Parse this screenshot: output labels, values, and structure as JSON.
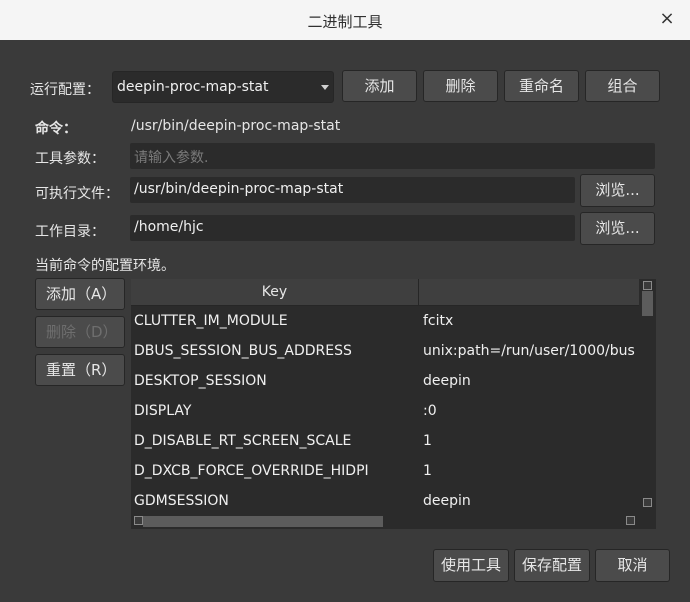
{
  "window": {
    "title": "二进制工具",
    "close_glyph": "×"
  },
  "config": {
    "label": "运行配置：",
    "selected": "deepin-proc-map-stat",
    "buttons": {
      "add": "添加",
      "delete": "删除",
      "rename": "重命名",
      "combine": "组合"
    }
  },
  "form": {
    "command_label": "命令：",
    "command_value": "/usr/bin/deepin-proc-map-stat",
    "args_label": "工具参数：",
    "args_placeholder": "请输入参数.",
    "exe_label": "可执行文件：",
    "exe_value": "/usr/bin/deepin-proc-map-stat",
    "browse1": "浏览...",
    "workdir_label": "工作目录：",
    "workdir_value": "/home/hjc",
    "browse2": "浏览..."
  },
  "env": {
    "title": "当前命令的配置环境。",
    "buttons": {
      "add": "添加（A）",
      "delete": "删除（D）",
      "reset": "重置（R）"
    },
    "columns": {
      "key": "Key",
      "value": ""
    },
    "rows": [
      {
        "key": "CLUTTER_IM_MODULE",
        "value": "fcitx"
      },
      {
        "key": "DBUS_SESSION_BUS_ADDRESS",
        "value": "unix:path=/run/user/1000/bus"
      },
      {
        "key": "DESKTOP_SESSION",
        "value": "deepin"
      },
      {
        "key": "DISPLAY",
        "value": ":0"
      },
      {
        "key": "D_DISABLE_RT_SCREEN_SCALE",
        "value": "1"
      },
      {
        "key": "D_DXCB_FORCE_OVERRIDE_HIDPI",
        "value": "1"
      },
      {
        "key": "GDMSESSION",
        "value": "deepin"
      }
    ]
  },
  "footer": {
    "use_tool": "使用工具",
    "save_config": "保存配置",
    "cancel": "取消"
  }
}
